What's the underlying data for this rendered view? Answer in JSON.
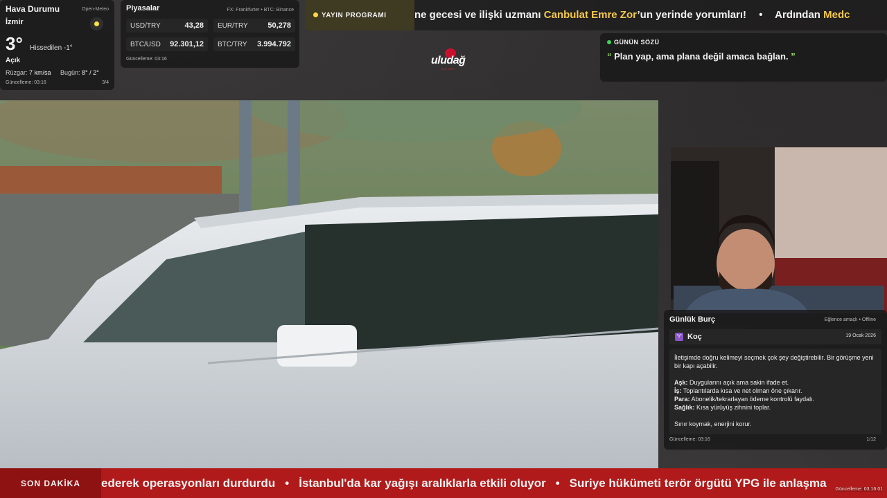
{
  "weather": {
    "title": "Hava Durumu",
    "source": "Open-Meteo",
    "city": "İzmir",
    "temperature": "3°",
    "feels_like": "Hissedilen -1°",
    "condition": "Açık",
    "wind_label": "Rüzgar:",
    "wind_value": "7 km/sa",
    "today_label": "Bugün:",
    "today_value": "8° / 2°",
    "updated": "Güncelleme: 03:16",
    "page": "3/4",
    "icon": "sun-icon",
    "icon_color": "#ffe23d"
  },
  "markets": {
    "title": "Piyasalar",
    "source": "FX: Frankfurter • BTC: Binance",
    "items": [
      {
        "name": "USD/TRY",
        "value": "43,28"
      },
      {
        "name": "EUR/TRY",
        "value": "50,278"
      },
      {
        "name": "BTC/USD",
        "value": "92.301,12"
      },
      {
        "name": "BTC/TRY",
        "value": "3.994.792"
      }
    ],
    "updated": "Güncelleme: 03:16"
  },
  "schedule": {
    "label": "YAYIN PROGRAMI",
    "text_before": "ne gecesi ve ilişki uzmanı ",
    "highlight": "Canbulat Emre Zor",
    "text_after": "’un yerinde yorumları!",
    "bullet": "•",
    "next_before": "Ardından ",
    "next_highlight": "Medc",
    "highlight_color": "#f5c84c"
  },
  "logo": {
    "word": "uludağ",
    "sub": "İÇECEK"
  },
  "quote": {
    "label": "GÜNÜN SÖZÜ",
    "open_mark": "“",
    "text": "Plan yap, ama plana değil amaca bağlan.",
    "close_mark": "”",
    "accent": "#9be86a"
  },
  "horoscope": {
    "title": "Günlük Burç",
    "meta": "Eğlence amaçlı • Offline",
    "sign_icon": "aries-icon",
    "sign": "Koç",
    "date": "19 Ocak 2026",
    "intro": "İletişimde doğru kelimeyi seçmek çok şey değiştirebilir. Bir görüşme yeni bir kapı açabilir.",
    "lines": [
      {
        "key": "Aşk:",
        "text": "Duygularını açık ama sakin ifade et."
      },
      {
        "key": "İş:",
        "text": "Toplantılarda kısa ve net olman öne çıkarır."
      },
      {
        "key": "Para:",
        "text": "Abonelik/tekrarlayan ödeme kontrolü faydalı."
      },
      {
        "key": "Sağlık:",
        "text": "Kısa yürüyüş zihnini toplar."
      }
    ],
    "closing": "Sınır koymak, enerjini korur.",
    "updated": "Güncelleme: 03:16",
    "page": "1/12"
  },
  "ticker": {
    "label": "SON DAKİKA",
    "items": [
      "ederek operasyonları durdurdu",
      "İstanbul'da kar yağışı aralıklarla etkili oluyor",
      "Suriye hükümeti terör örgütü YPG ile anlaşma"
    ],
    "bullet": "•",
    "updated": "Güncelleme: 03:16:01",
    "color": "#b11a1a"
  }
}
